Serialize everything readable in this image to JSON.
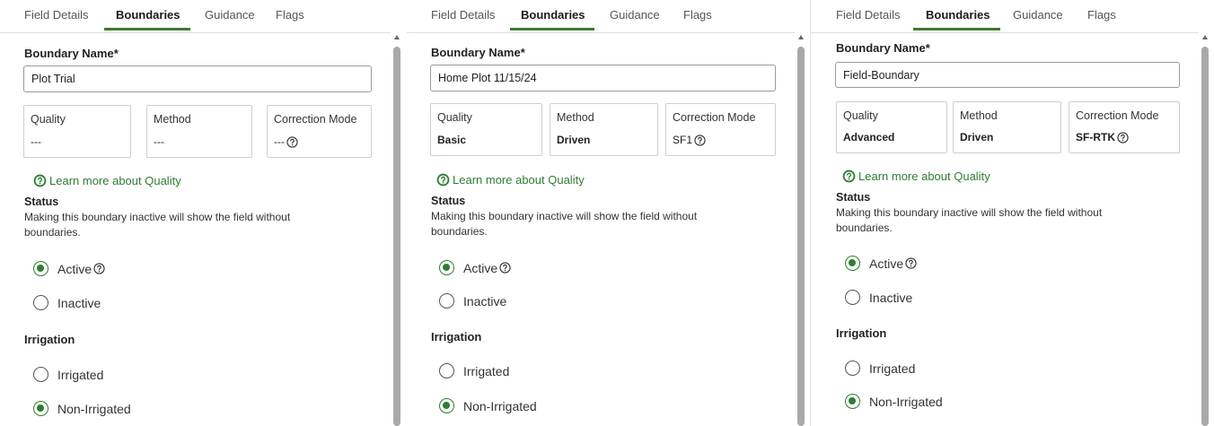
{
  "panels": [
    {
      "tabs": [
        "Field Details",
        "Boundaries",
        "Guidance",
        "Flags"
      ],
      "active_tab": "Boundaries",
      "boundary_name_label": "Boundary Name*",
      "boundary_name_value": "Plot Trial",
      "quality_label": "Quality",
      "quality_value": "---",
      "method_label": "Method",
      "method_value": "---",
      "correction_label": "Correction Mode",
      "correction_value": "---",
      "learn_more": "Learn more about Quality",
      "status_title": "Status",
      "status_desc": "Making this boundary inactive will show the field without boundaries.",
      "active_label": "Active",
      "inactive_label": "Inactive",
      "status_selected": "Active",
      "irrigation_title": "Irrigation",
      "irrigated_label": "Irrigated",
      "non_irrigated_label": "Non-Irrigated",
      "irrigation_selected": "Non-Irrigated"
    },
    {
      "tabs": [
        "Field Details",
        "Boundaries",
        "Guidance",
        "Flags"
      ],
      "active_tab": "Boundaries",
      "boundary_name_label": "Boundary Name*",
      "boundary_name_value": "Home Plot 11/15/24",
      "quality_label": "Quality",
      "quality_value": "Basic",
      "method_label": "Method",
      "method_value": "Driven",
      "correction_label": "Correction Mode",
      "correction_value": "SF1",
      "learn_more": "Learn more about Quality",
      "status_title": "Status",
      "status_desc": "Making this boundary inactive will show the field without boundaries.",
      "active_label": "Active",
      "inactive_label": "Inactive",
      "status_selected": "Active",
      "irrigation_title": "Irrigation",
      "irrigated_label": "Irrigated",
      "non_irrigated_label": "Non-Irrigated",
      "irrigation_selected": "Non-Irrigated"
    },
    {
      "tabs": [
        "Field Details",
        "Boundaries",
        "Guidance",
        "Flags"
      ],
      "active_tab": "Boundaries",
      "boundary_name_label": "Boundary Name*",
      "boundary_name_value": "Field-Boundary",
      "quality_label": "Quality",
      "quality_value": "Advanced",
      "method_label": "Method",
      "method_value": "Driven",
      "correction_label": "Correction Mode",
      "correction_value": "SF-RTK",
      "learn_more": "Learn more about Quality",
      "status_title": "Status",
      "status_desc": "Making this boundary inactive will show the field without boundaries.",
      "active_label": "Active",
      "inactive_label": "Inactive",
      "status_selected": "Active",
      "irrigation_title": "Irrigation",
      "irrigated_label": "Irrigated",
      "non_irrigated_label": "Non-Irrigated",
      "irrigation_selected": "Non-Irrigated"
    }
  ],
  "colors": {
    "accent_green": "#2e7d32",
    "tab_underline": "#3c7a30",
    "scroll_thumb": "#a9a9a9"
  },
  "icons": {
    "help": "question-circle-icon",
    "learn": "question-circle-filled-icon"
  }
}
